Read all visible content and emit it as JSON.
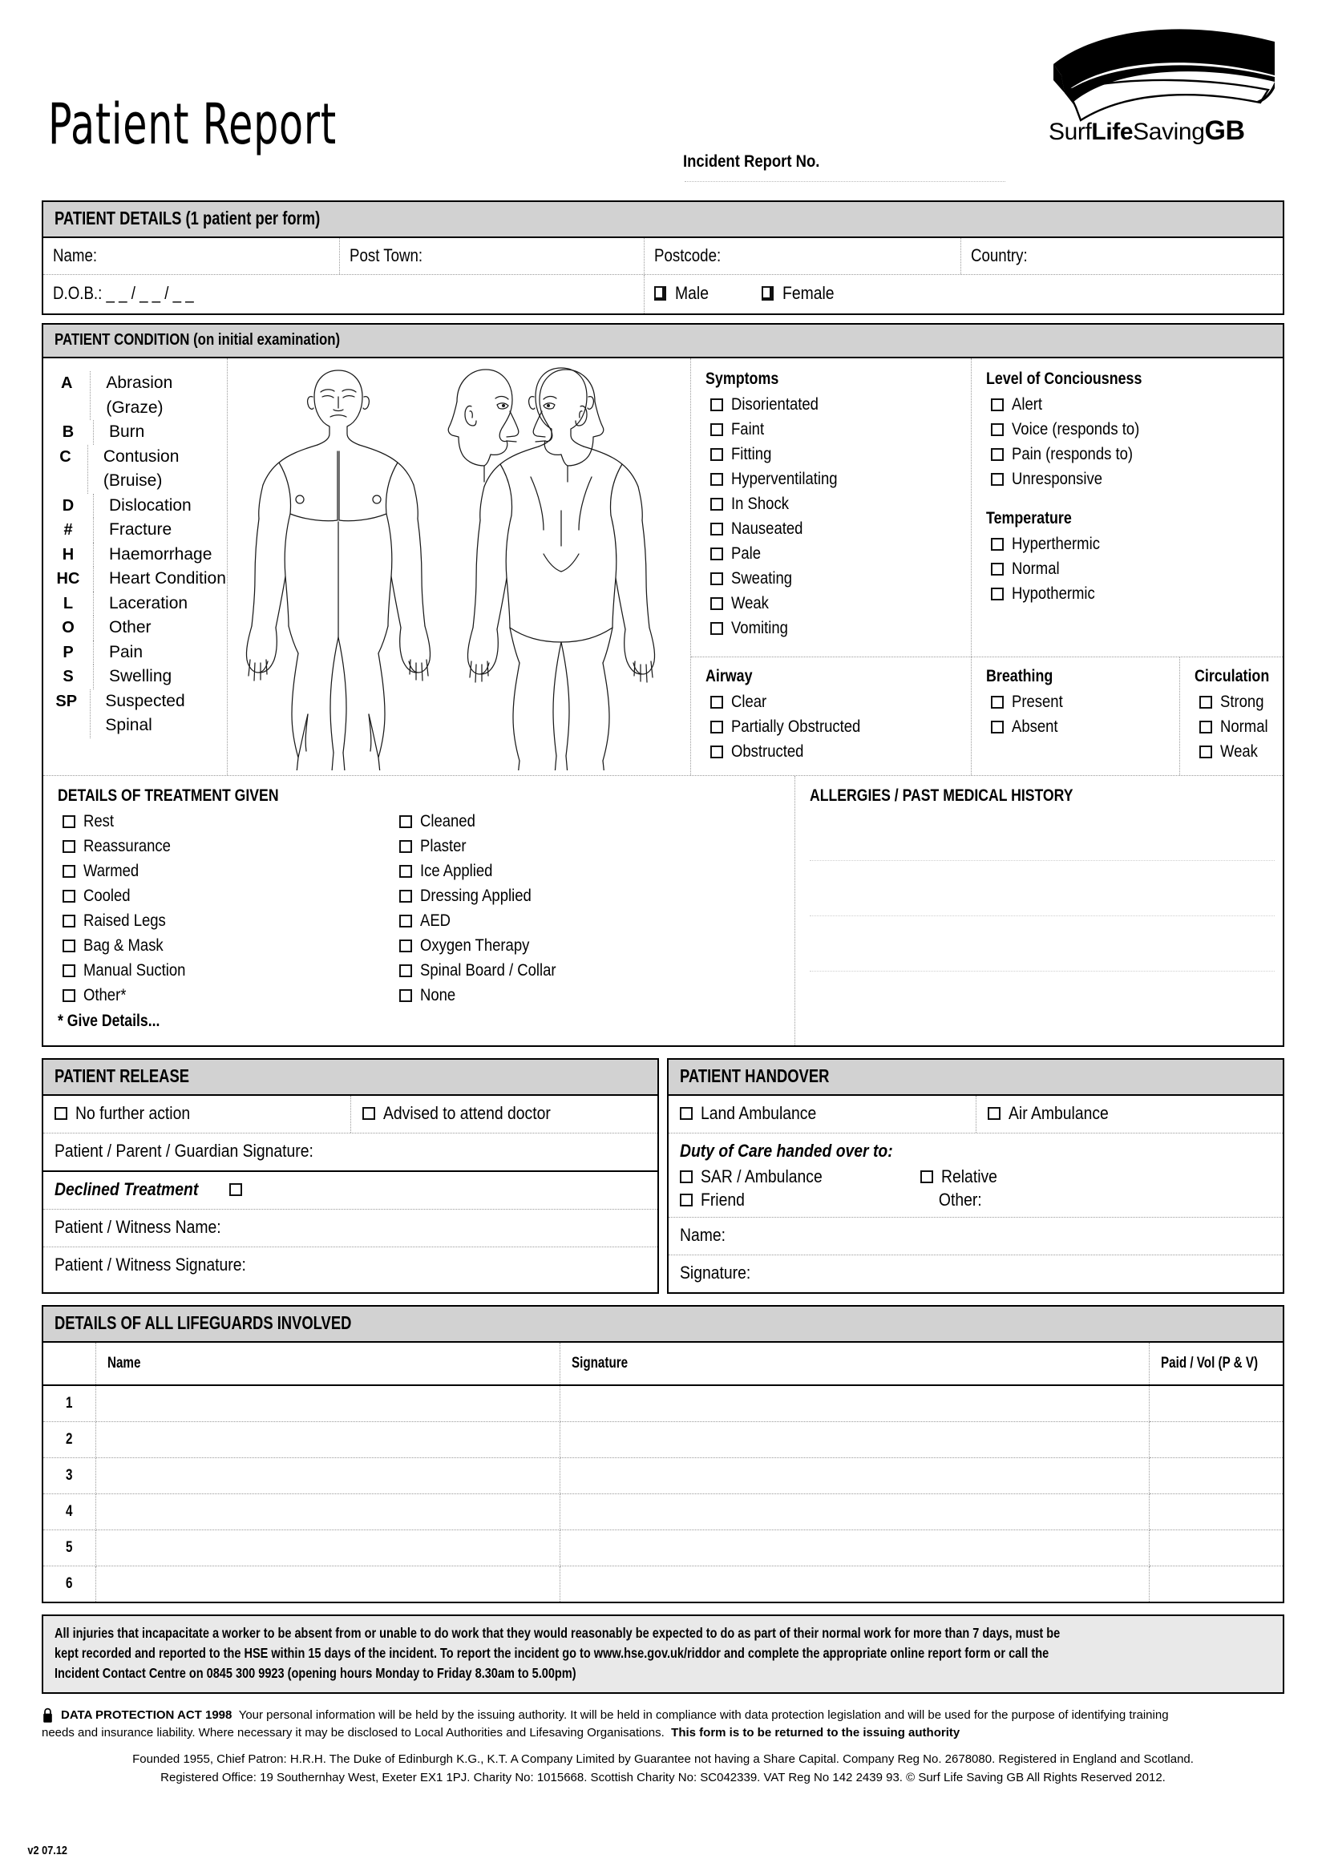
{
  "header": {
    "title": "Patient Report",
    "incident_report_label": "Incident Report No.",
    "logo_text_surf": "Surf",
    "logo_text_life": "Life",
    "logo_text_saving": "Saving",
    "logo_text_gb": "GB"
  },
  "patient_details": {
    "section_title": "PATIENT DETAILS (1 patient per form)",
    "name_label": "Name:",
    "post_town_label": "Post Town:",
    "postcode_label": "Postcode:",
    "country_label": "Country:",
    "dob_label": "D.O.B.: _ _ / _ _ / _ _",
    "male_label": "Male",
    "female_label": "Female"
  },
  "patient_condition": {
    "section_title": "PATIENT CONDITION (on initial examination)",
    "injury_codes": [
      {
        "code": "A",
        "label": "Abrasion (Graze)"
      },
      {
        "code": "B",
        "label": "Burn"
      },
      {
        "code": "C",
        "label": "Contusion (Bruise)"
      },
      {
        "code": "D",
        "label": "Dislocation"
      },
      {
        "code": "#",
        "label": "Fracture"
      },
      {
        "code": "H",
        "label": "Haemorrhage"
      },
      {
        "code": "HC",
        "label": "Heart Condition"
      },
      {
        "code": "L",
        "label": "Laceration"
      },
      {
        "code": "O",
        "label": "Other"
      },
      {
        "code": "P",
        "label": "Pain"
      },
      {
        "code": "S",
        "label": "Swelling"
      },
      {
        "code": "SP",
        "label": "Suspected Spinal"
      }
    ],
    "symptoms_title": "Symptoms",
    "symptoms": [
      "Disorientated",
      "Faint",
      "Fitting",
      "Hyperventilating",
      "In Shock",
      "Nauseated",
      "Pale",
      "Sweating",
      "Weak",
      "Vomiting"
    ],
    "consciousness_title": "Level of Conciousness",
    "consciousness": [
      "Alert",
      "Voice (responds to)",
      "Pain (responds to)",
      "Unresponsive"
    ],
    "temperature_title": "Temperature",
    "temperature": [
      "Hyperthermic",
      "Normal",
      "Hypothermic"
    ],
    "airway_title": "Airway",
    "airway": [
      "Clear",
      "Partially Obstructed",
      "Obstructed"
    ],
    "breathing_title": "Breathing",
    "breathing": [
      "Present",
      "Absent"
    ],
    "circulation_title": "Circulation",
    "circulation": [
      "Strong",
      "Normal",
      "Weak"
    ]
  },
  "treatment": {
    "title": "DETAILS OF TREATMENT GIVEN",
    "column_left": [
      "Rest",
      "Reassurance",
      "Warmed",
      "Cooled",
      "Raised Legs",
      "Bag & Mask",
      "Manual Suction",
      "Other*"
    ],
    "column_right": [
      "Cleaned",
      "Plaster",
      "Ice Applied",
      "Dressing Applied",
      "AED",
      "Oxygen Therapy",
      "Spinal Board / Collar",
      "None"
    ],
    "give_details": "* Give Details..."
  },
  "allergies": {
    "title": "ALLERGIES / PAST MEDICAL HISTORY"
  },
  "patient_release": {
    "title": "PATIENT RELEASE",
    "no_further_action": "No further action",
    "advised_doctor": "Advised to attend doctor",
    "guardian_signature": "Patient / Parent / Guardian Signature:",
    "declined_treatment": "Declined Treatment",
    "witness_name": "Patient / Witness Name:",
    "witness_signature": "Patient / Witness Signature:"
  },
  "patient_handover": {
    "title": "PATIENT HANDOVER",
    "land_ambulance": "Land Ambulance",
    "air_ambulance": "Air Ambulance",
    "duty_of_care": "Duty of Care handed over to:",
    "sar_ambulance": "SAR / Ambulance",
    "relative": "Relative",
    "friend": "Friend",
    "other": "Other:",
    "name_label": "Name:",
    "signature_label": "Signature:"
  },
  "lifeguards": {
    "title": "DETAILS OF ALL LIFEGUARDS INVOLVED",
    "columns": [
      "",
      "Name",
      "Signature",
      "Paid / Vol (P & V)"
    ],
    "rows": [
      "1",
      "2",
      "3",
      "4",
      "5",
      "6"
    ]
  },
  "riddor_notice": {
    "line1": "All injuries that incapacitate a worker to be absent from or unable to do work that they would reasonably be expected to do as part of their normal work for more than 7 days, must be",
    "line2": "kept recorded and reported to the HSE within 15 days of the incident. To report the incident go to www.hse.gov.uk/riddor and complete the appropriate online report form or call the",
    "line3": "Incident Contact Centre on 0845 300 9923 (opening hours Monday to Friday 8.30am to 5.00pm)"
  },
  "data_protection": {
    "heading": "DATA PROTECTION ACT 1998",
    "body1": "Your personal information will be held by the issuing authority. It will be held in compliance with data protection legislation and will be used for the purpose of identifying training",
    "body2": "needs and insurance liability. Where necessary it may be disclosed to Local Authorities and Lifesaving Organisations.",
    "bold_tail": "This form is to be returned to the issuing authority"
  },
  "footer": {
    "line1": "Founded 1955, Chief Patron: H.R.H. The Duke of Edinburgh K.G., K.T. A Company Limited by Guarantee not having a Share Capital. Company Reg No. 2678080.  Registered in England and Scotland.",
    "line2": "Registered Office: 19 Southernhay West, Exeter EX1 1PJ. Charity No: 1015668. Scottish Charity No: SC042339. VAT Reg No 142 2439 93.  © Surf Life Saving GB All Rights Reserved 2012.",
    "version": "v2 07.12"
  },
  "colors": {
    "section_header_bg": "#d2d2d2",
    "notice_bg": "#e9e9e9",
    "rule": "#000000"
  }
}
